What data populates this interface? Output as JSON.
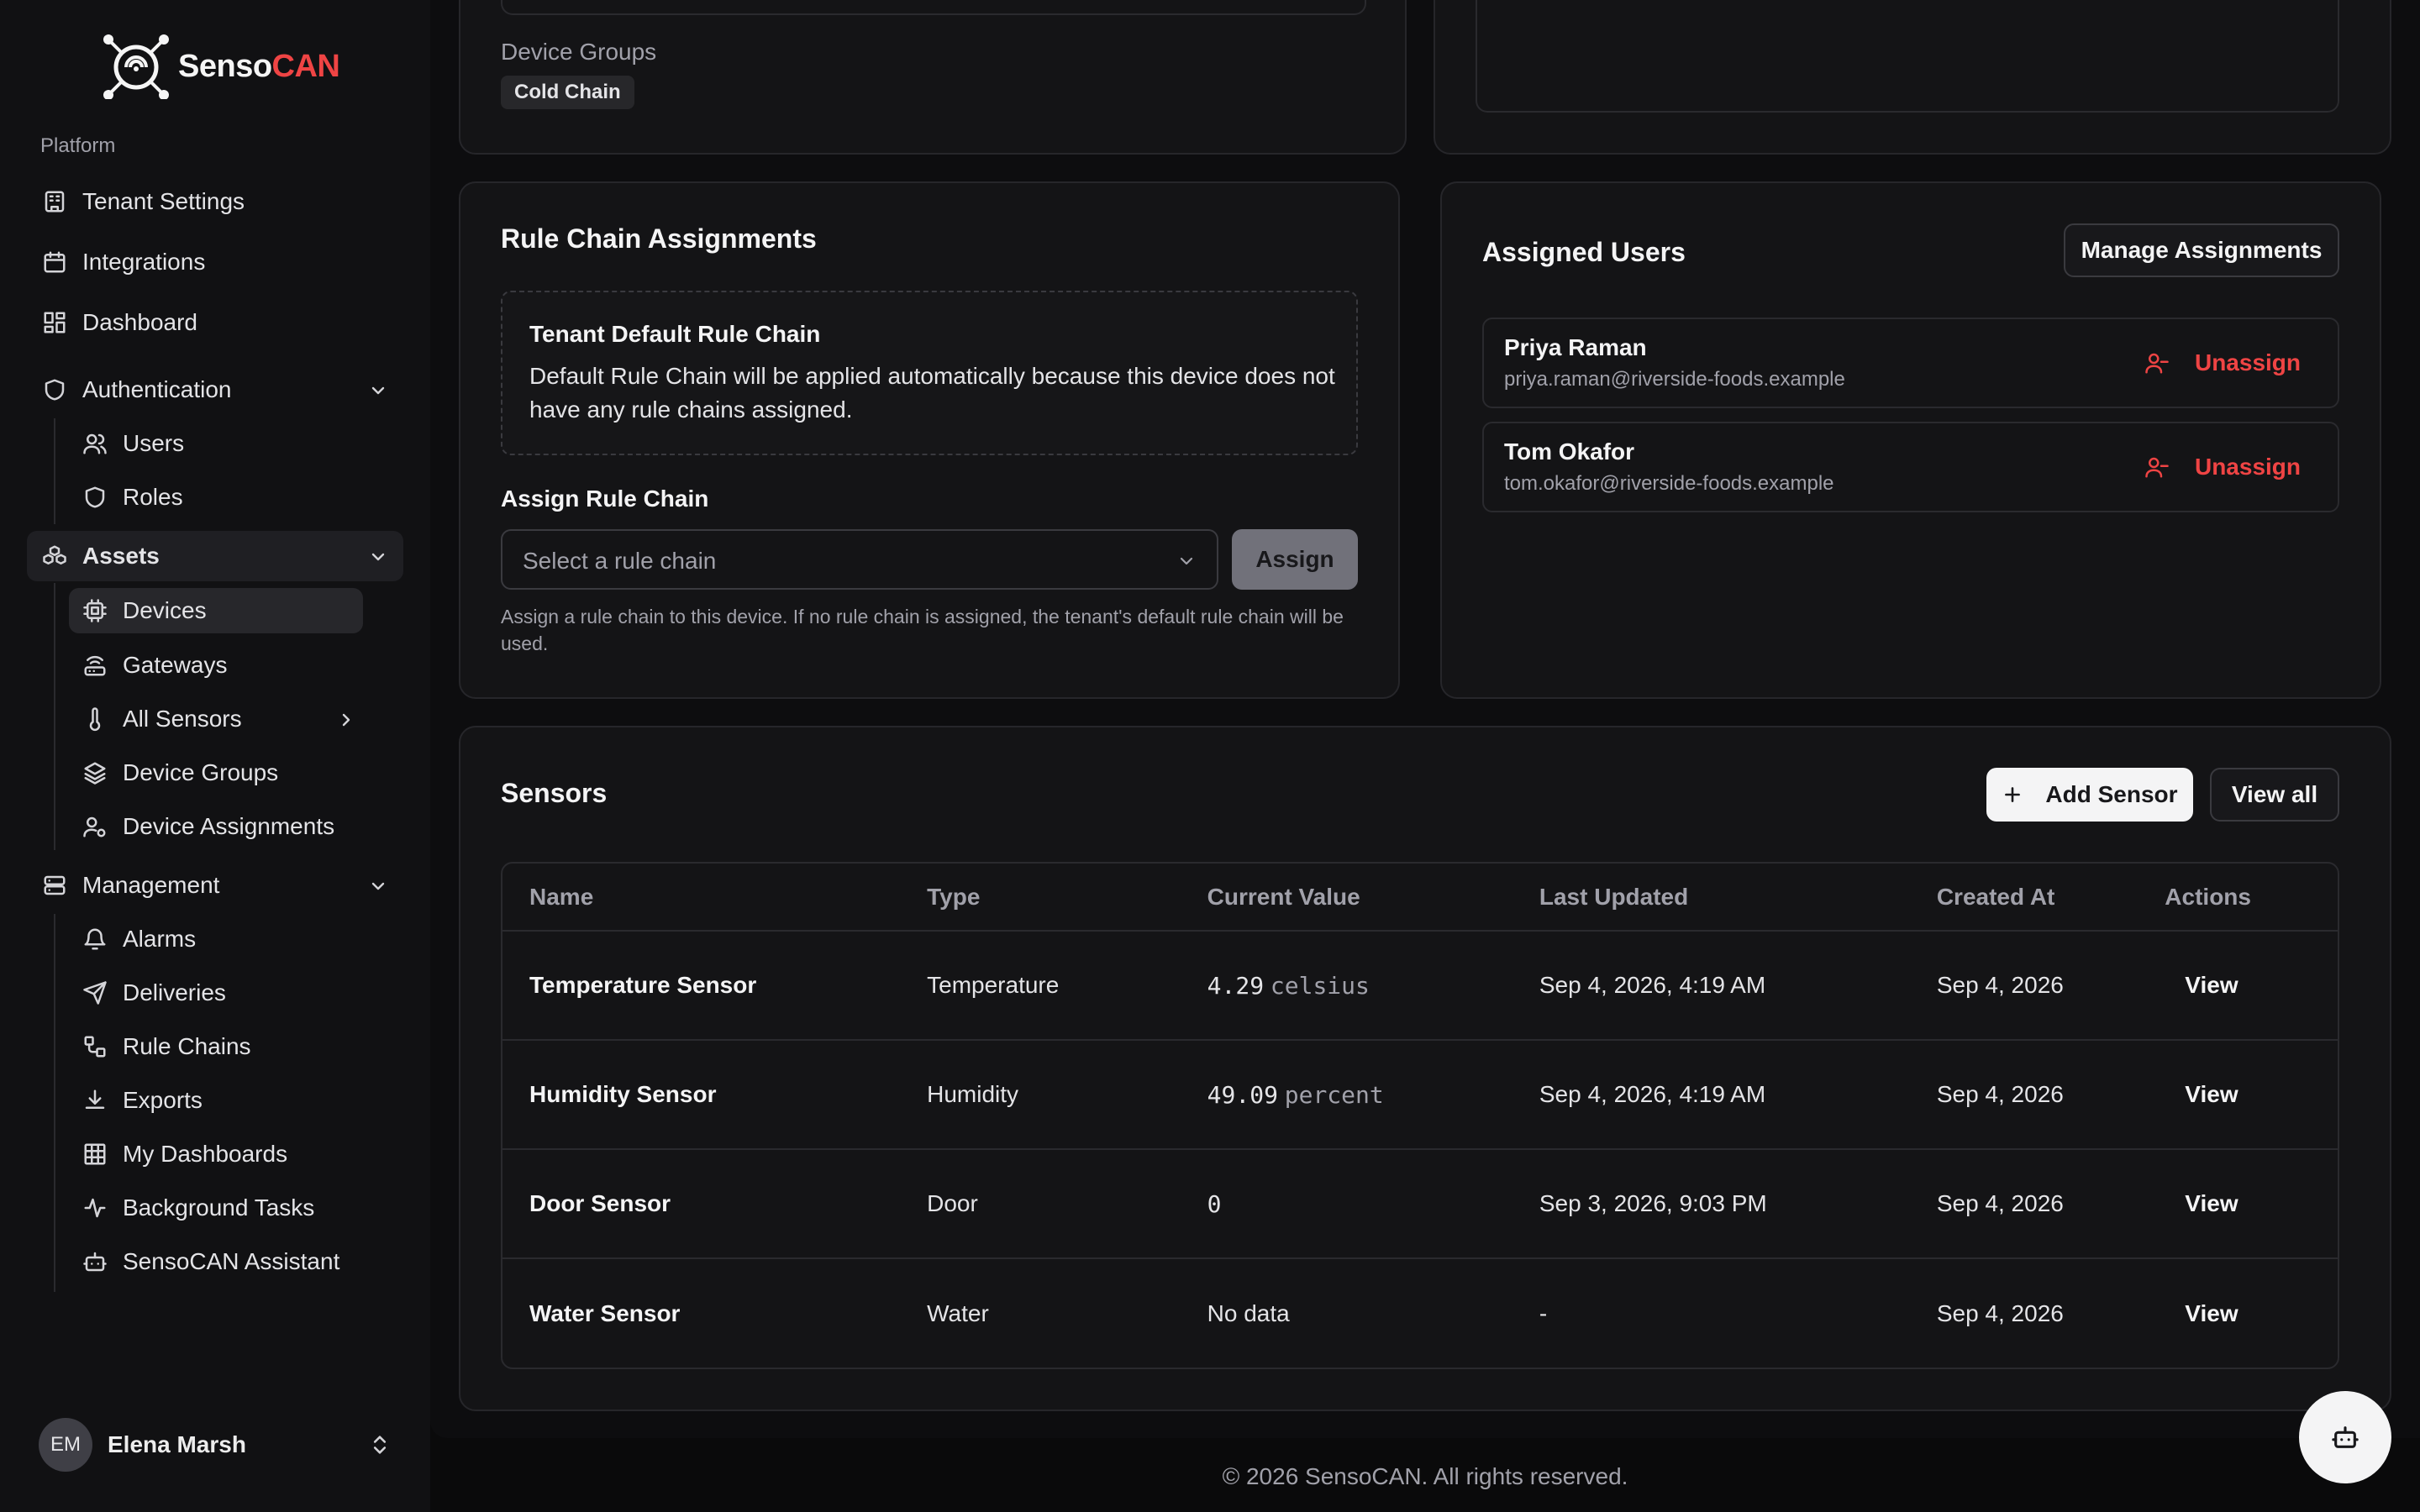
{
  "brand": {
    "name_a": "Senso",
    "name_b": "CAN"
  },
  "sidebar": {
    "section_label": "Platform",
    "items": [
      {
        "label": "Tenant Settings",
        "icon": "building-icon"
      },
      {
        "label": "Integrations",
        "icon": "calendar-icon"
      },
      {
        "label": "Dashboard",
        "icon": "dashboard-icon"
      },
      {
        "label": "Authentication",
        "icon": "shield-icon"
      },
      {
        "label": "Users",
        "icon": "users-icon"
      },
      {
        "label": "Roles",
        "icon": "shield-icon"
      },
      {
        "label": "Assets",
        "icon": "boxes-icon"
      },
      {
        "label": "Devices",
        "icon": "cpu-icon"
      },
      {
        "label": "Gateways",
        "icon": "router-icon"
      },
      {
        "label": "All Sensors",
        "icon": "thermometer-icon"
      },
      {
        "label": "Device Groups",
        "icon": "layers-icon"
      },
      {
        "label": "Device Assignments",
        "icon": "user-cog-icon"
      },
      {
        "label": "Management",
        "icon": "server-icon"
      },
      {
        "label": "Alarms",
        "icon": "bell-icon"
      },
      {
        "label": "Deliveries",
        "icon": "send-icon"
      },
      {
        "label": "Rule Chains",
        "icon": "workflow-icon"
      },
      {
        "label": "Exports",
        "icon": "download-icon"
      },
      {
        "label": "My Dashboards",
        "icon": "grid-icon"
      },
      {
        "label": "Background Tasks",
        "icon": "activity-icon"
      },
      {
        "label": "SensoCAN Assistant",
        "icon": "bot-icon"
      }
    ],
    "user": {
      "initials": "EM",
      "name": "Elena Marsh"
    }
  },
  "device_groups": {
    "label": "Device Groups",
    "chip": "Cold Chain"
  },
  "rule_chain": {
    "title": "Rule Chain Assignments",
    "default_title": "Tenant Default Rule Chain",
    "default_desc": "Default Rule Chain will be applied automatically because this device does not have any rule chains assigned.",
    "assign_label": "Assign Rule Chain",
    "select_placeholder": "Select a rule chain",
    "assign_button": "Assign",
    "help": "Assign a rule chain to this device. If no rule chain is assigned, the tenant's default rule chain will be used."
  },
  "assigned_users": {
    "title": "Assigned Users",
    "manage_button": "Manage Assignments",
    "unassign_label": "Unassign",
    "users": [
      {
        "name": "Priya Raman",
        "email": "priya.raman@riverside-foods.example"
      },
      {
        "name": "Tom Okafor",
        "email": "tom.okafor@riverside-foods.example"
      }
    ]
  },
  "sensors": {
    "title": "Sensors",
    "add_button": "Add Sensor",
    "view_all_button": "View all",
    "columns": [
      "Name",
      "Type",
      "Current Value",
      "Last Updated",
      "Created At",
      "Actions"
    ],
    "rows": [
      {
        "name": "Temperature Sensor",
        "type": "Temperature",
        "value": "4.29",
        "unit": "celsius",
        "updated": "Sep 4, 2026, 4:19 AM",
        "created": "Sep 4, 2026",
        "action": "View"
      },
      {
        "name": "Humidity Sensor",
        "type": "Humidity",
        "value": "49.09",
        "unit": "percent",
        "updated": "Sep 4, 2026, 4:19 AM",
        "created": "Sep 4, 2026",
        "action": "View"
      },
      {
        "name": "Door Sensor",
        "type": "Door",
        "value": "0",
        "unit": "",
        "updated": "Sep 3, 2026, 9:03 PM",
        "created": "Sep 4, 2026",
        "action": "View"
      },
      {
        "name": "Water Sensor",
        "type": "Water",
        "value": "No data",
        "unit": "",
        "updated": "-",
        "created": "Sep 4, 2026",
        "action": "View"
      }
    ]
  },
  "footer": "© 2026 SensoCAN. All rights reserved."
}
